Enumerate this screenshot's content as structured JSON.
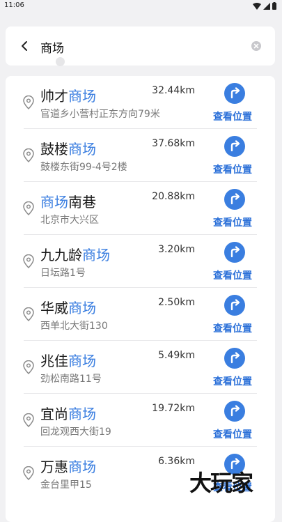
{
  "status": {
    "time": "11:06"
  },
  "search": {
    "query": "商场"
  },
  "results": [
    {
      "name_pre": "帅才",
      "name_hl": "商场",
      "name_post": "",
      "address": "官道乡小营村正东方向79米",
      "distance": "32.44km",
      "action": "查看位置"
    },
    {
      "name_pre": "鼓楼",
      "name_hl": "商场",
      "name_post": "",
      "address": "鼓楼东街99-4号2楼",
      "distance": "37.68km",
      "action": "查看位置"
    },
    {
      "name_pre": "",
      "name_hl": "商场",
      "name_post": "南巷",
      "address": "北京市大兴区",
      "distance": "20.88km",
      "action": "查看位置"
    },
    {
      "name_pre": "九九龄",
      "name_hl": "商场",
      "name_post": "",
      "address": "日坛路1号",
      "distance": "3.20km",
      "action": "查看位置"
    },
    {
      "name_pre": "华威",
      "name_hl": "商场",
      "name_post": "",
      "address": "西单北大街130",
      "distance": "2.50km",
      "action": "查看位置"
    },
    {
      "name_pre": "兆佳",
      "name_hl": "商场",
      "name_post": "",
      "address": "劲松南路11号",
      "distance": "5.49km",
      "action": "查看位置"
    },
    {
      "name_pre": "宜尚",
      "name_hl": "商场",
      "name_post": "",
      "address": "回龙观西大街19",
      "distance": "19.72km",
      "action": "查看位置"
    },
    {
      "name_pre": "万惠",
      "name_hl": "商场",
      "name_post": "",
      "address": "金台里甲15",
      "distance": "6.36km",
      "action": "查看位置"
    }
  ],
  "watermark": "大玩家",
  "colors": {
    "accent": "#3a7ee0",
    "link": "#2a6fd8"
  }
}
